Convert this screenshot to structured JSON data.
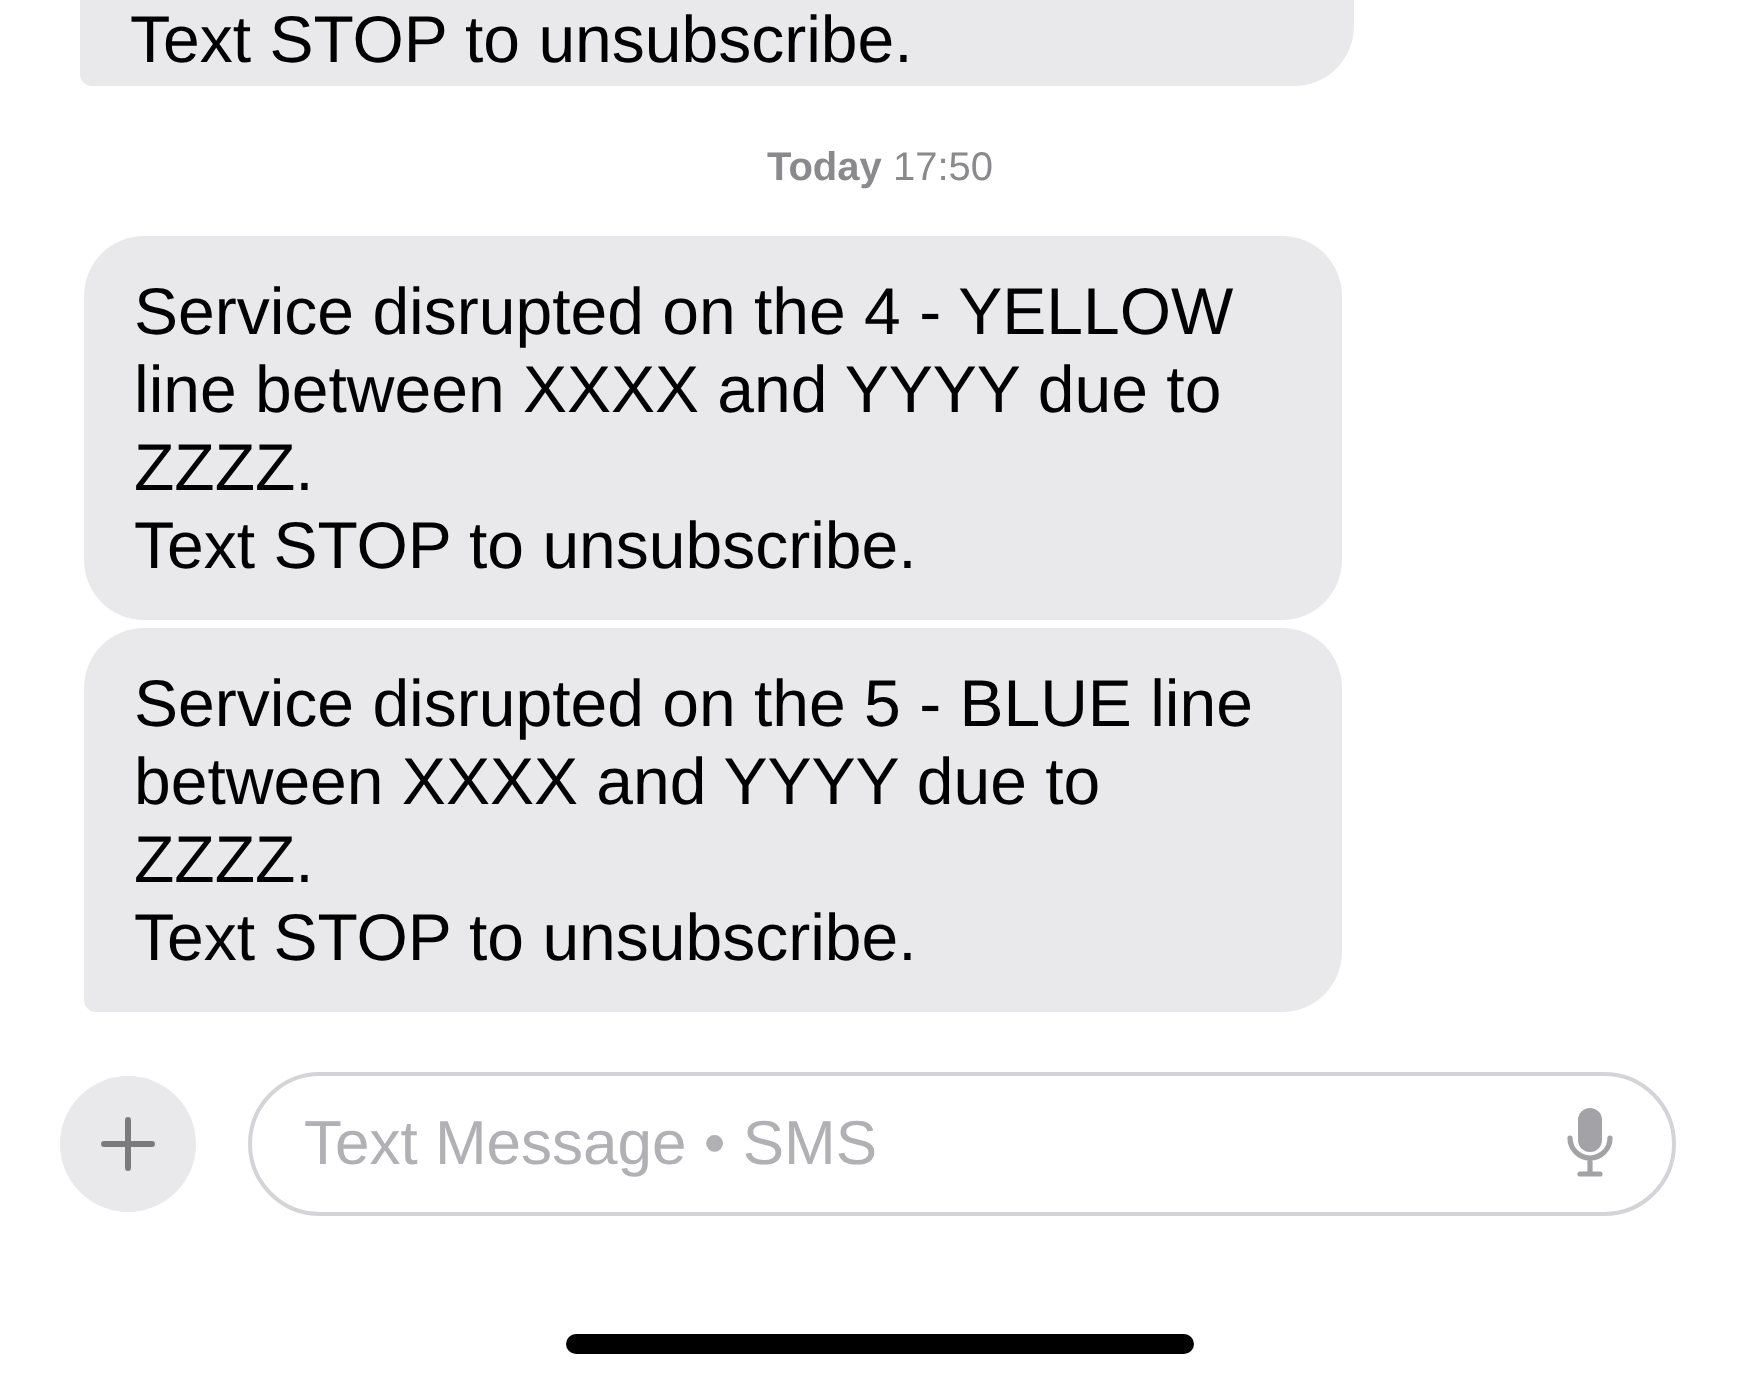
{
  "earlier_message": {
    "text": "Text STOP to unsubscribe.",
    "tail": true
  },
  "timestamp": "**Today** 17:50",
  "messages": [
    {
      "text": "Service disrupted on the 4 - YELLOW line between XXXX and YYYY due to ZZZZ.\nText STOP to unsubscribe.",
      "tail": false
    },
    {
      "text": "Service disrupted on the 5 - BLUE line between XXXX and YYYY due to ZZZZ.\nText STOP to unsubscribe.",
      "tail": true
    }
  ],
  "composer": {
    "placeholder": "Text Message • SMS"
  }
}
